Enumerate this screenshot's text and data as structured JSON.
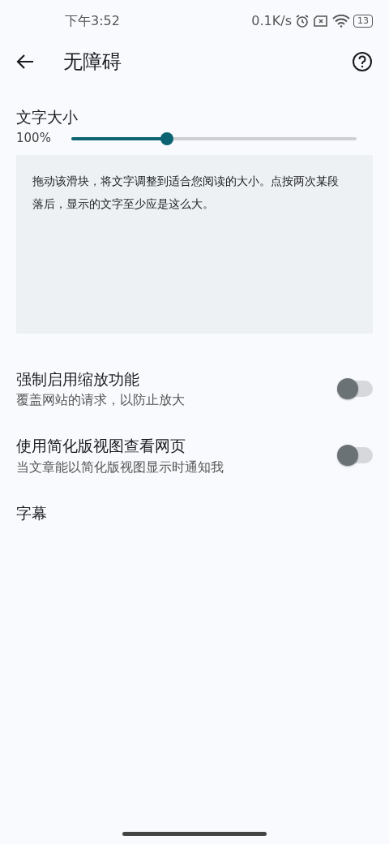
{
  "status_bar": {
    "time": "下午3:52",
    "net_speed": "0.1K/s",
    "battery": "13"
  },
  "app_bar": {
    "title": "无障碍"
  },
  "text_size": {
    "label": "文字大小",
    "reading": "100%",
    "level": 0.335,
    "preview": "拖动该滑块，将文字调整到适合您阅读的大小。点按两次某段落后，显示的文字至少应是这么大。"
  },
  "settings": [
    {
      "kind": "toggle",
      "title": "强制启用缩放功能",
      "subtitle": "覆盖网站的请求，以防止放大",
      "on": false
    },
    {
      "kind": "toggle",
      "title": "使用简化版视图查看网页",
      "subtitle": "当文章能以简化版视图显示时通知我",
      "on": false
    },
    {
      "kind": "link",
      "title": "字幕"
    }
  ]
}
